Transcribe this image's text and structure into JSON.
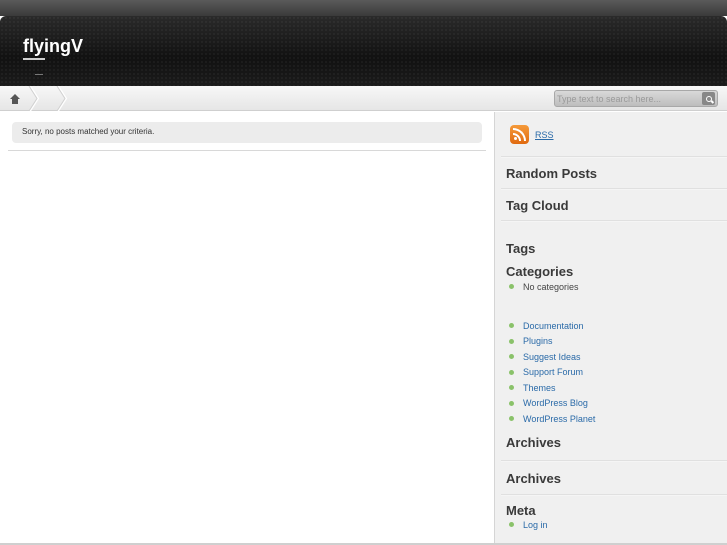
{
  "header": {
    "site_title": "flyingV"
  },
  "search": {
    "placeholder": "Type text to search here..."
  },
  "main": {
    "notice": "Sorry, no posts matched your criteria."
  },
  "sidebar": {
    "rss_label": "RSS",
    "widgets": {
      "random_posts": "Random Posts",
      "tag_cloud": "Tag Cloud",
      "tags": "Tags",
      "categories": "Categories",
      "archives_1": "Archives",
      "archives_2": "Archives",
      "meta": "Meta"
    },
    "categories_items": [
      "No categories"
    ],
    "links": [
      "Documentation",
      "Plugins",
      "Suggest Ideas",
      "Support Forum",
      "Themes",
      "WordPress Blog",
      "WordPress Planet"
    ],
    "meta_items": [
      "Log in"
    ]
  },
  "colors": {
    "link": "#2a6aa8",
    "bullet": "#8ac26a",
    "rss": "#e8761a"
  }
}
